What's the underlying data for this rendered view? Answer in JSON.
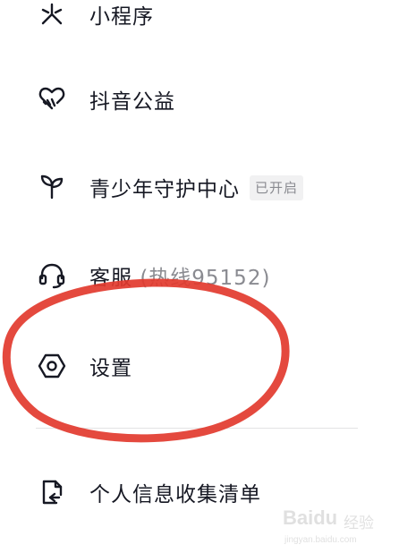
{
  "menu": {
    "items": [
      {
        "icon": "mini-program-icon",
        "label": "小程序"
      },
      {
        "icon": "charity-heart-icon",
        "label": "抖音公益"
      },
      {
        "icon": "sprout-icon",
        "label": "青少年守护中心",
        "badge": "已开启"
      },
      {
        "icon": "headset-icon",
        "label": "客服",
        "label_suffix": "(热线95152)"
      },
      {
        "icon": "settings-hexagon-icon",
        "label": "设置"
      },
      {
        "icon": "document-icon",
        "label": "个人信息收集清单"
      }
    ]
  },
  "annotation": {
    "color": "#e23a2e",
    "target": "设置"
  },
  "watermark": {
    "logo": "Baidu",
    "cn": "经验",
    "url": "jingyan.baidu.com"
  }
}
